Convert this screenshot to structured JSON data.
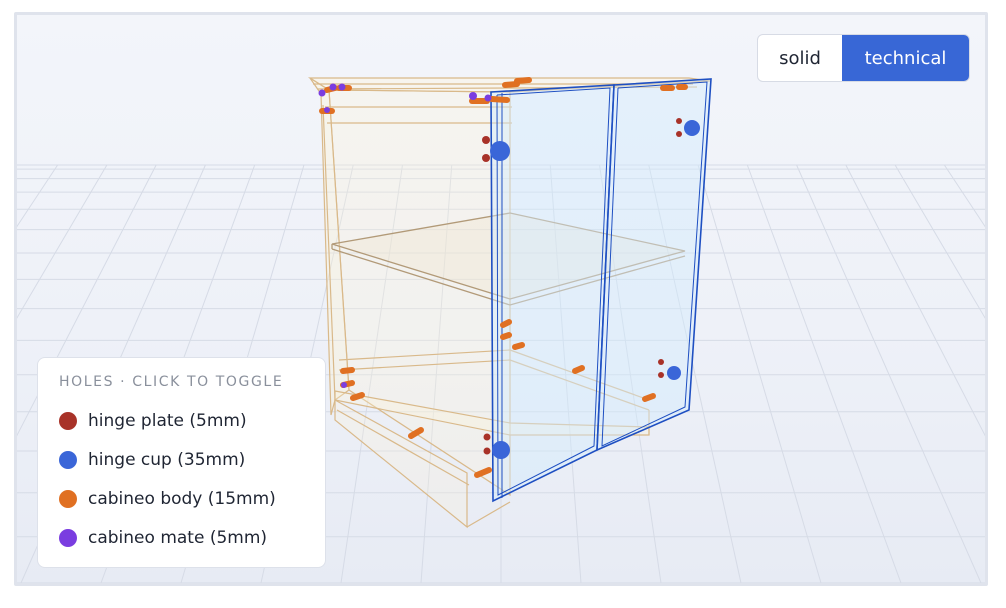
{
  "toggle": {
    "options": [
      {
        "label": "solid",
        "active": false
      },
      {
        "label": "technical",
        "active": true
      }
    ]
  },
  "legend": {
    "title": "HOLES · CLICK TO TOGGLE",
    "items": [
      {
        "label": "hinge plate (5mm)",
        "color": "#a83228"
      },
      {
        "label": "hinge cup (35mm)",
        "color": "#3a66d8"
      },
      {
        "label": "cabineo body (15mm)",
        "color": "#e07022"
      },
      {
        "label": "cabineo mate (5mm)",
        "color": "#7a3de0"
      }
    ]
  },
  "colors": {
    "accent": "#3867d6",
    "carcass_line": "#d9b98a",
    "door_line": "#1e4fc2",
    "grid_line": "#d6dbe6"
  }
}
